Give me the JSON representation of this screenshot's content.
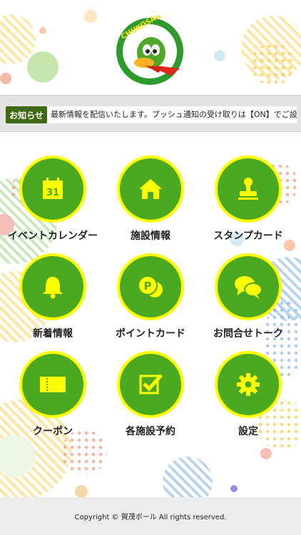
{
  "header": {
    "logo_text": "CHUKOSANGYO"
  },
  "news": {
    "label": "お知らせ",
    "text": "最新情報を配信いたします。プッシュ通知の受け取りは【ON】でご設定お願いいたします。"
  },
  "menu": [
    {
      "label": "イベントカレンダー",
      "icon": "calendar-icon",
      "icon_text": "31"
    },
    {
      "label": "施設情報",
      "icon": "home-icon"
    },
    {
      "label": "スタンプカード",
      "icon": "stamp-icon"
    },
    {
      "label": "新着情報",
      "icon": "bell-icon"
    },
    {
      "label": "ポイントカード",
      "icon": "coin-icon",
      "icon_text": "P"
    },
    {
      "label": "お問合せトーク",
      "icon": "chat-icon"
    },
    {
      "label": "クーポン",
      "icon": "ticket-icon"
    },
    {
      "label": "各施設予約",
      "icon": "checkbox-icon"
    },
    {
      "label": "設定",
      "icon": "gear-icon"
    }
  ],
  "footer": {
    "copyright": "Copyright © 賀茂ボール All rights reserved."
  },
  "colors": {
    "icon_green": "#4aa821",
    "icon_ring": "#ffff00",
    "news_label": "#3f6a12"
  }
}
